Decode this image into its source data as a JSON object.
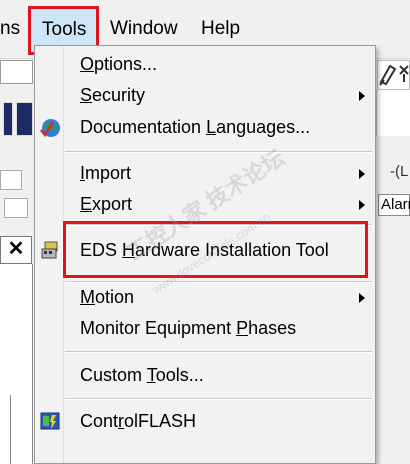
{
  "menubar": {
    "items": [
      {
        "label": "ns"
      },
      {
        "label": "Tools"
      },
      {
        "label": "Window"
      },
      {
        "label": "Help"
      }
    ]
  },
  "background": {
    "close_glyph": "✕",
    "right_text_1": "-(L",
    "right_text_2": "Alarr"
  },
  "tools_menu": {
    "items": [
      {
        "label": "Options...",
        "mnemonic": "O"
      },
      {
        "label": "Security",
        "mnemonic": "S",
        "submenu": true
      },
      {
        "label": "Documentation Languages...",
        "mnemonic": "L",
        "icon": "globe-icon"
      },
      {
        "label": "Import",
        "mnemonic": "I",
        "submenu": true
      },
      {
        "label": "Export",
        "mnemonic": "E",
        "submenu": true
      },
      {
        "label": "EDS Hardware Installation Tool",
        "mnemonic": "H",
        "icon": "eds-tool-icon",
        "highlighted_annotation": true
      },
      {
        "label": "Motion",
        "mnemonic": "M",
        "submenu": true
      },
      {
        "label": "Monitor Equipment Phases",
        "mnemonic": "P"
      },
      {
        "label": "Custom Tools...",
        "mnemonic": "T"
      },
      {
        "label": "ControlFLASH",
        "mnemonic": "r",
        "icon": "controlflash-icon"
      }
    ]
  },
  "watermark": {
    "text": "工控人家 技术论坛",
    "subtext": "www.ilovecontrols.com.cn"
  },
  "colors": {
    "annotation_red": "#e0151b",
    "menu_bg": "#f2f2f2",
    "hover_blue": "#cde6f7"
  }
}
